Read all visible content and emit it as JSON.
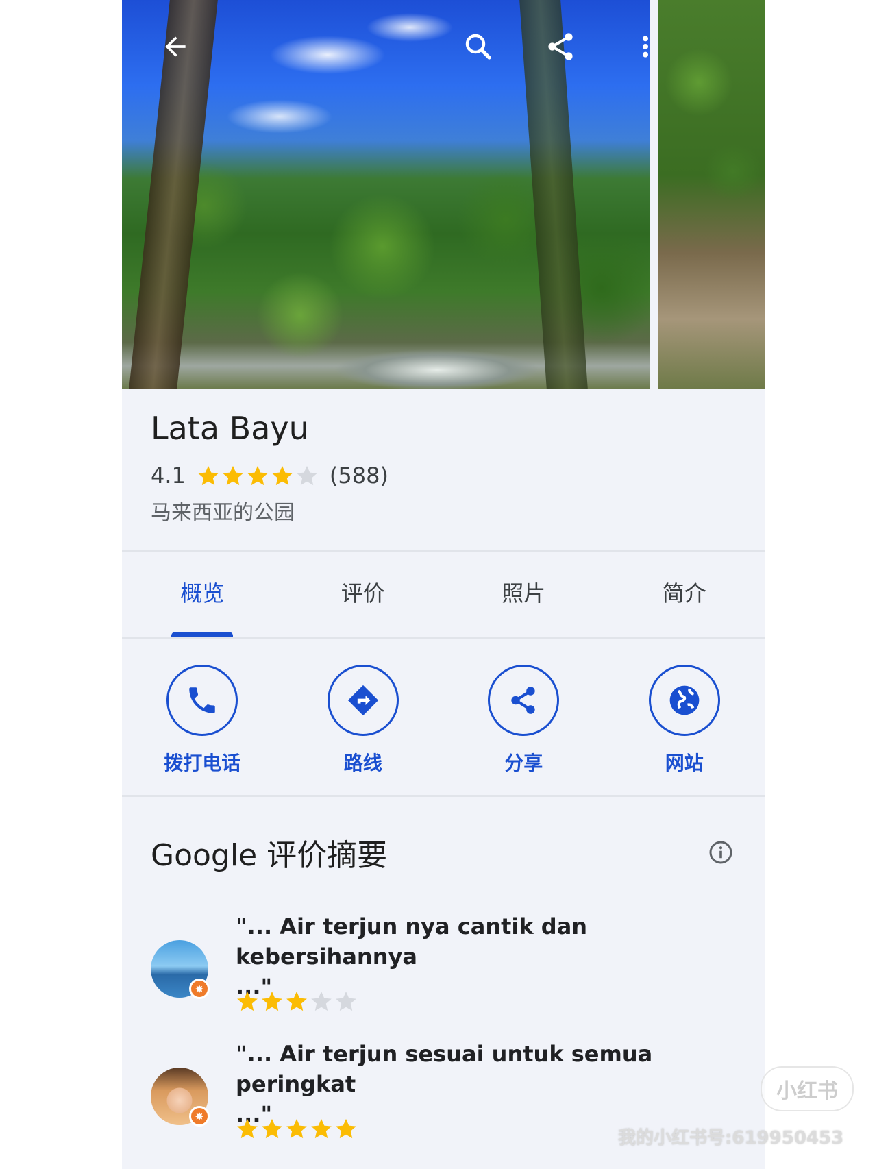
{
  "place": {
    "name": "Lata Bayu",
    "rating": "4.1",
    "rating_value": 4.1,
    "review_count": "(588)",
    "category": "马来西亚的公园"
  },
  "top_bar": {
    "back": "back-arrow-icon",
    "search": "search-icon",
    "share": "share-icon",
    "more": "more-vert-icon"
  },
  "tabs": [
    {
      "label": "概览",
      "active": true
    },
    {
      "label": "评价",
      "active": false
    },
    {
      "label": "照片",
      "active": false
    },
    {
      "label": "简介",
      "active": false
    }
  ],
  "actions": [
    {
      "label": "拨打电话",
      "icon": "phone-icon"
    },
    {
      "label": "路线",
      "icon": "directions-icon"
    },
    {
      "label": "分享",
      "icon": "share-icon"
    },
    {
      "label": "网站",
      "icon": "globe-icon"
    }
  ],
  "summary": {
    "title": "Google 评价摘要"
  },
  "reviews": [
    {
      "quote_line1": "\"... Air terjun nya cantik dan kebersihannya",
      "quote_line2": "...\"",
      "stars": 3
    },
    {
      "quote_line1": "\"... Air terjun sesuai untuk semua peringkat",
      "quote_line2": "...\"",
      "stars": 5
    }
  ],
  "watermark": {
    "logo": "小红书",
    "text": "我的小红书号:619950453"
  },
  "colors": {
    "accent": "#1a4fd0",
    "star": "#fbbc04",
    "star_empty": "#d5d8de",
    "background": "#f1f3f9"
  }
}
